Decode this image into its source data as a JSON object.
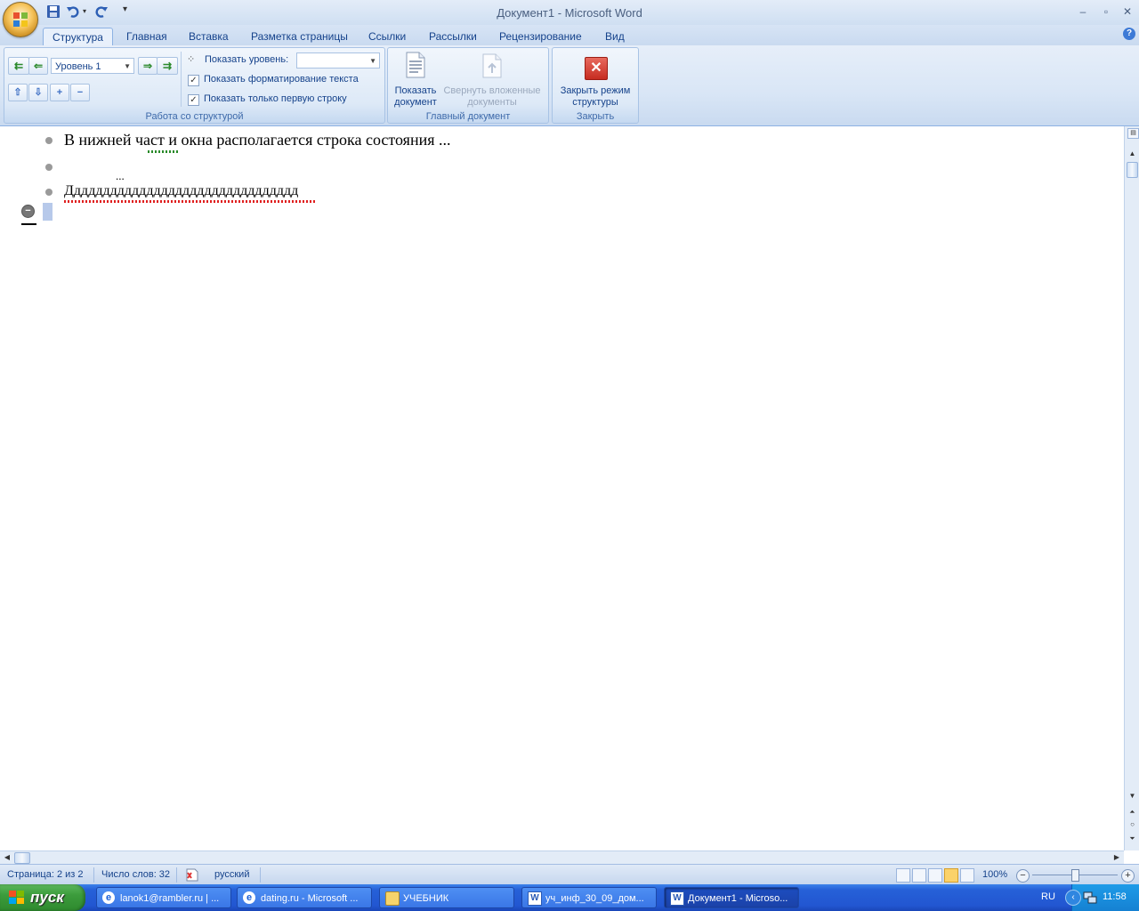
{
  "window": {
    "title": "Документ1 - Microsoft Word"
  },
  "tabs": [
    {
      "label": "Структура"
    },
    {
      "label": "Главная"
    },
    {
      "label": "Вставка"
    },
    {
      "label": "Разметка страницы"
    },
    {
      "label": "Ссылки"
    },
    {
      "label": "Рассылки"
    },
    {
      "label": "Рецензирование"
    },
    {
      "label": "Вид"
    }
  ],
  "ribbon": {
    "outline_group": {
      "label": "Работа со структурой",
      "level_value": "Уровень 1",
      "show_level_label": "Показать уровень:",
      "show_level_value": "",
      "show_formatting_label": "Показать форматирование текста",
      "show_formatting_checked": true,
      "first_line_only_label": "Показать только первую строку",
      "first_line_only_checked": true
    },
    "master_group": {
      "label": "Главный документ",
      "show_document": "Показать документ",
      "collapse_subdocs": "Свернуть вложенные документы"
    },
    "close_group": {
      "label": "Закрыть",
      "close_outline": "Закрыть режим структуры"
    }
  },
  "document": {
    "lines": [
      {
        "text": "В нижней част  и окна располагается строка состояния ..."
      },
      {
        "text": "..."
      },
      {
        "text": "Дддддддддддддддддддддддддддддддд"
      },
      {
        "text": ""
      }
    ]
  },
  "statusbar": {
    "page": "Страница: 2 из 2",
    "words": "Число слов: 32",
    "language": "русский",
    "zoom": "100%"
  },
  "taskbar": {
    "start": "пуск",
    "tasks": [
      {
        "label": "lanok1@rambler.ru | ...",
        "active": false
      },
      {
        "label": "dating.ru - Microsoft ...",
        "active": false
      },
      {
        "label": "УЧЕБНИК",
        "active": false
      },
      {
        "label": "уч_инф_30_09_дом...",
        "active": false
      },
      {
        "label": "Документ1 - Microso...",
        "active": true
      }
    ],
    "lang": "RU",
    "clock": "11:58"
  },
  "colors": {
    "ribbon_text": "#15428b",
    "taskbar_blue": "#2256d1",
    "start_green": "#3c9c3c",
    "close_red": "#d9352b"
  }
}
